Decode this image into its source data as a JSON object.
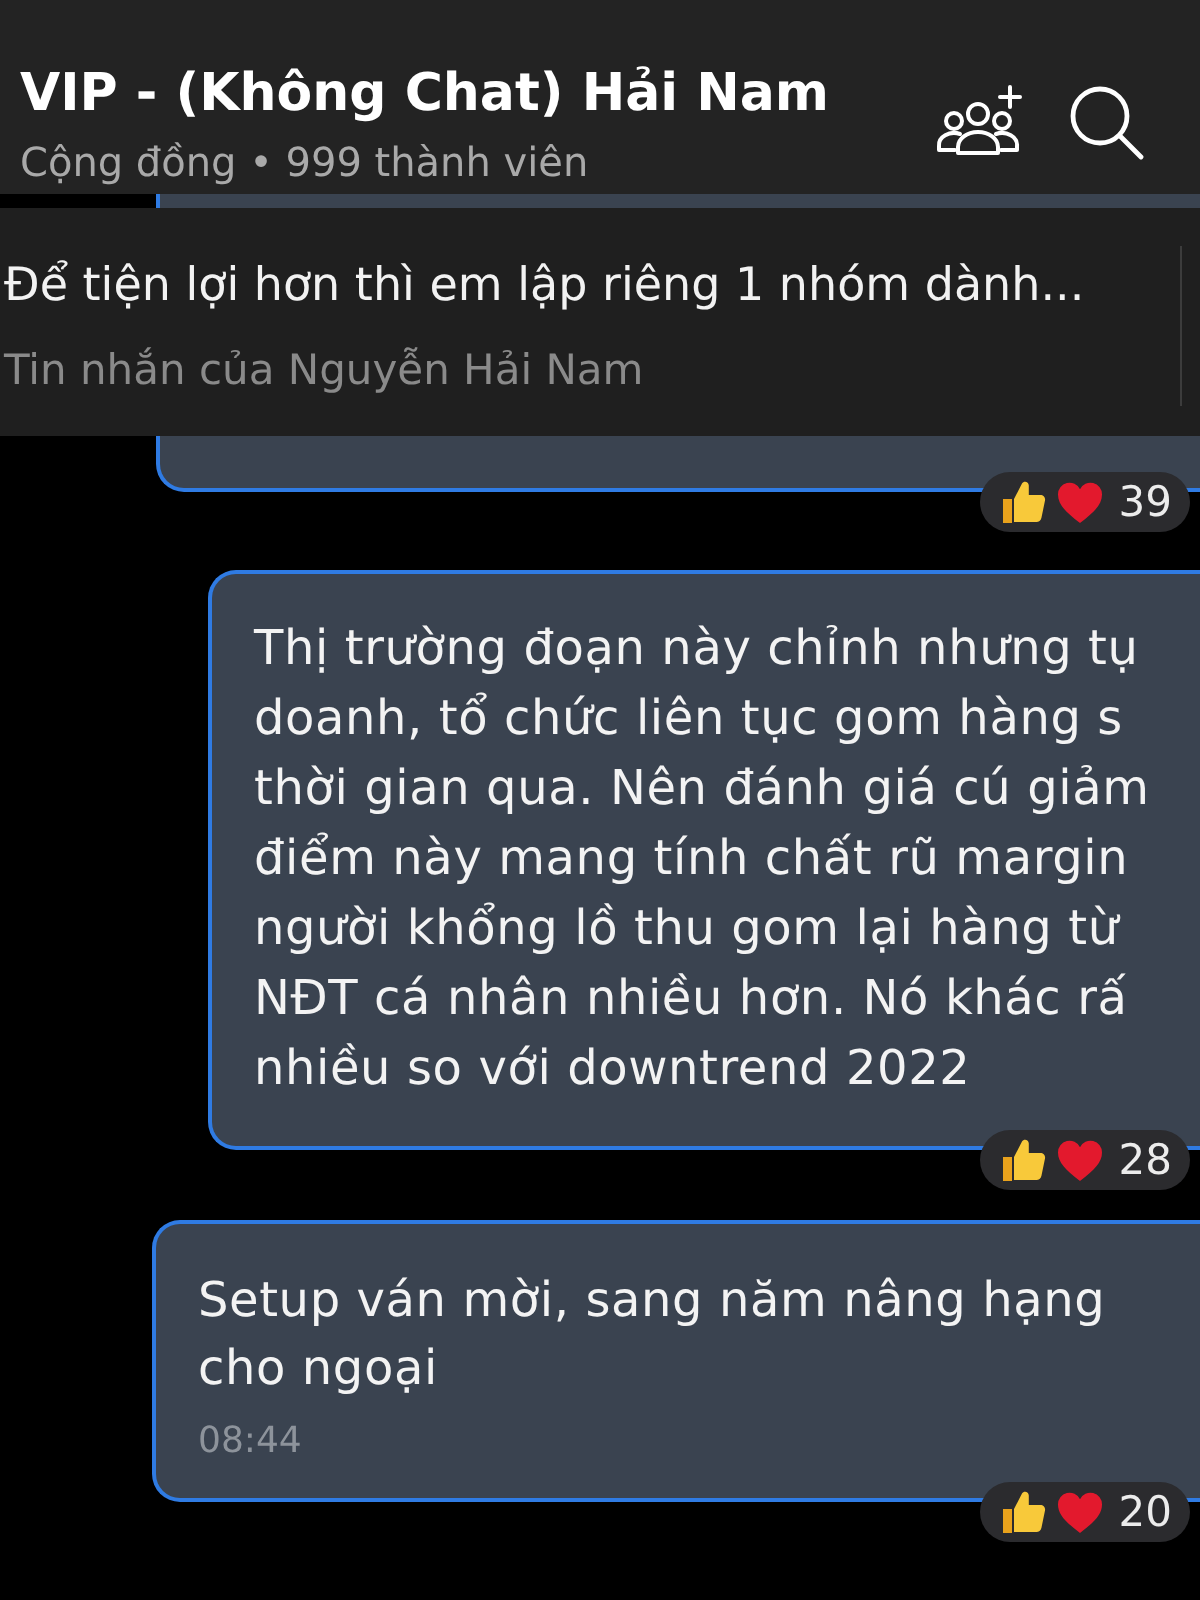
{
  "header": {
    "title": "VIP - (Không Chat) Hải Nam",
    "subtitle": "Cộng đồng • 999 thành viên"
  },
  "pinned_message": {
    "text": "Để tiện lợi hơn thì em lập riêng 1 nhóm dành...",
    "sender": "Tin nhắn của Nguyễn Hải Nam"
  },
  "messages": [
    {
      "kind": "covered",
      "reaction_count": "39"
    },
    {
      "kind": "text",
      "text": "Thị trường đoạn này chỉnh nhưng tụ\ndoanh, tổ chức liên tục gom hàng s\nthời gian qua. Nên đánh giá cú giảm\nđiểm này mang tính chất rũ margin\nngười khổng lồ thu gom lại hàng từ\nNĐT cá nhân nhiều hơn. Nó khác rấ\nnhiều so với downtrend 2022",
      "reaction_count": "28"
    },
    {
      "kind": "text",
      "text": "Setup ván mời, sang năm nâng hạng\ncho ngoại",
      "time": "08:44",
      "reaction_count": "20"
    }
  ]
}
